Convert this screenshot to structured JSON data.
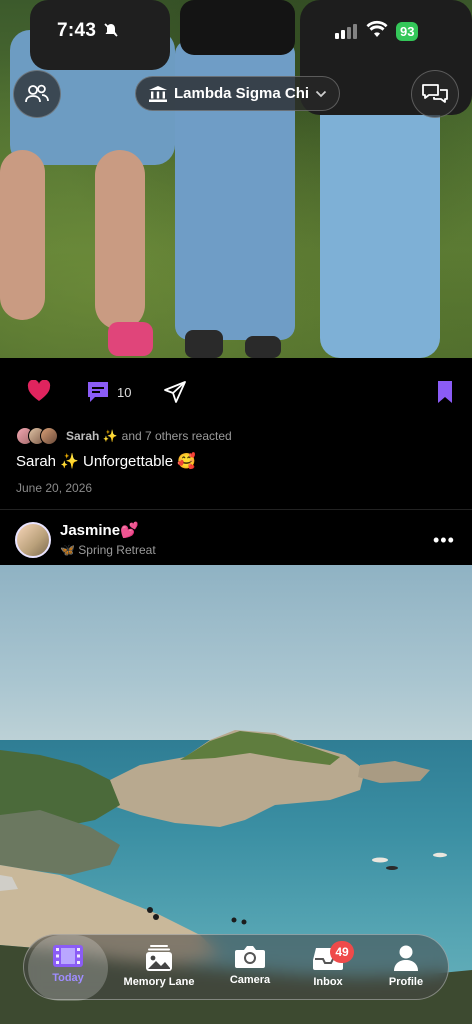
{
  "status_bar": {
    "time": "7:43",
    "battery": "93"
  },
  "header": {
    "group_name": "Lambda Sigma Chi"
  },
  "post1": {
    "comment_count": "10",
    "reacted_name": "Sarah ✨",
    "reacted_rest": "and 7 others reacted",
    "caption": "Sarah ✨ Unforgettable 🥰",
    "date": "June 20, 2026"
  },
  "post2": {
    "author": "Jasmine💕",
    "subtitle": "🦋 Spring Retreat",
    "more": "•••"
  },
  "tabbar": {
    "tabs": [
      {
        "label": "Today",
        "icon": "film-icon"
      },
      {
        "label": "Memory Lane",
        "icon": "photos-icon"
      },
      {
        "label": "Camera",
        "icon": "camera-icon"
      },
      {
        "label": "Inbox",
        "icon": "inbox-icon",
        "badge": "49"
      },
      {
        "label": "Profile",
        "icon": "person-icon"
      }
    ]
  },
  "colors": {
    "accent": "#8b5cf6",
    "badge": "#ef4a4a",
    "battery": "#34c759",
    "heart": "#e0245e"
  }
}
